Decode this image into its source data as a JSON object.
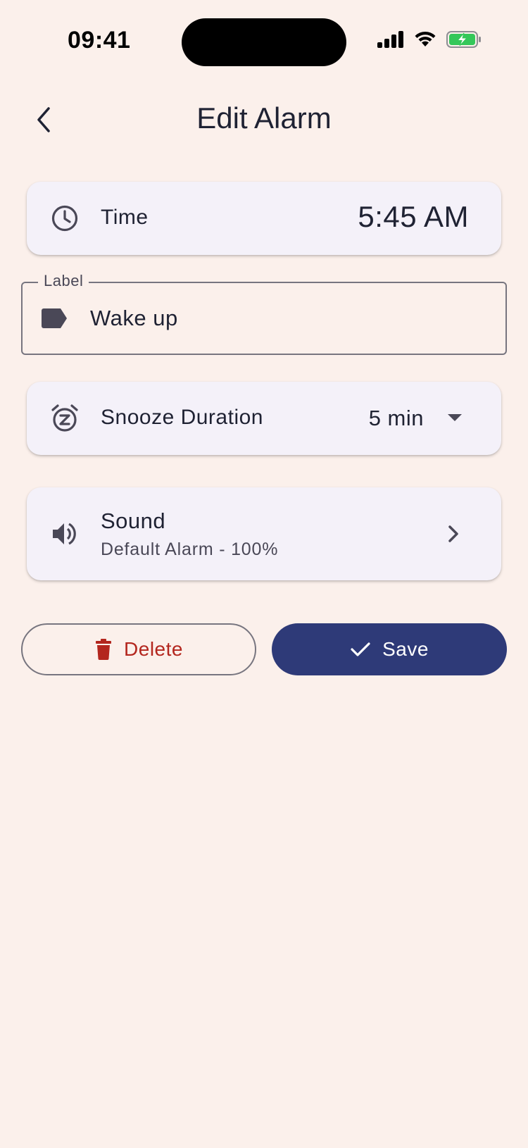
{
  "status_bar": {
    "time": "09:41"
  },
  "header": {
    "title": "Edit Alarm"
  },
  "time_card": {
    "label": "Time",
    "value": "5:45 AM"
  },
  "label_field": {
    "legend": "Label",
    "value": "Wake up"
  },
  "snooze_card": {
    "label": "Snooze Duration",
    "value": "5 min"
  },
  "sound_card": {
    "title": "Sound",
    "subtitle": "Default Alarm - 100%"
  },
  "actions": {
    "delete_label": "Delete",
    "save_label": "Save"
  },
  "colors": {
    "background": "#FBF0EB",
    "card": "#F4F1F9",
    "primary": "#2E3A78",
    "danger": "#B3261E",
    "battery": "#34C759"
  },
  "icons": {
    "back": "chevron-left-icon",
    "time": "clock-icon",
    "label": "label-tag-icon",
    "snooze": "snooze-alarm-icon",
    "sound": "volume-icon",
    "delete": "trash-icon",
    "save": "check-icon"
  }
}
